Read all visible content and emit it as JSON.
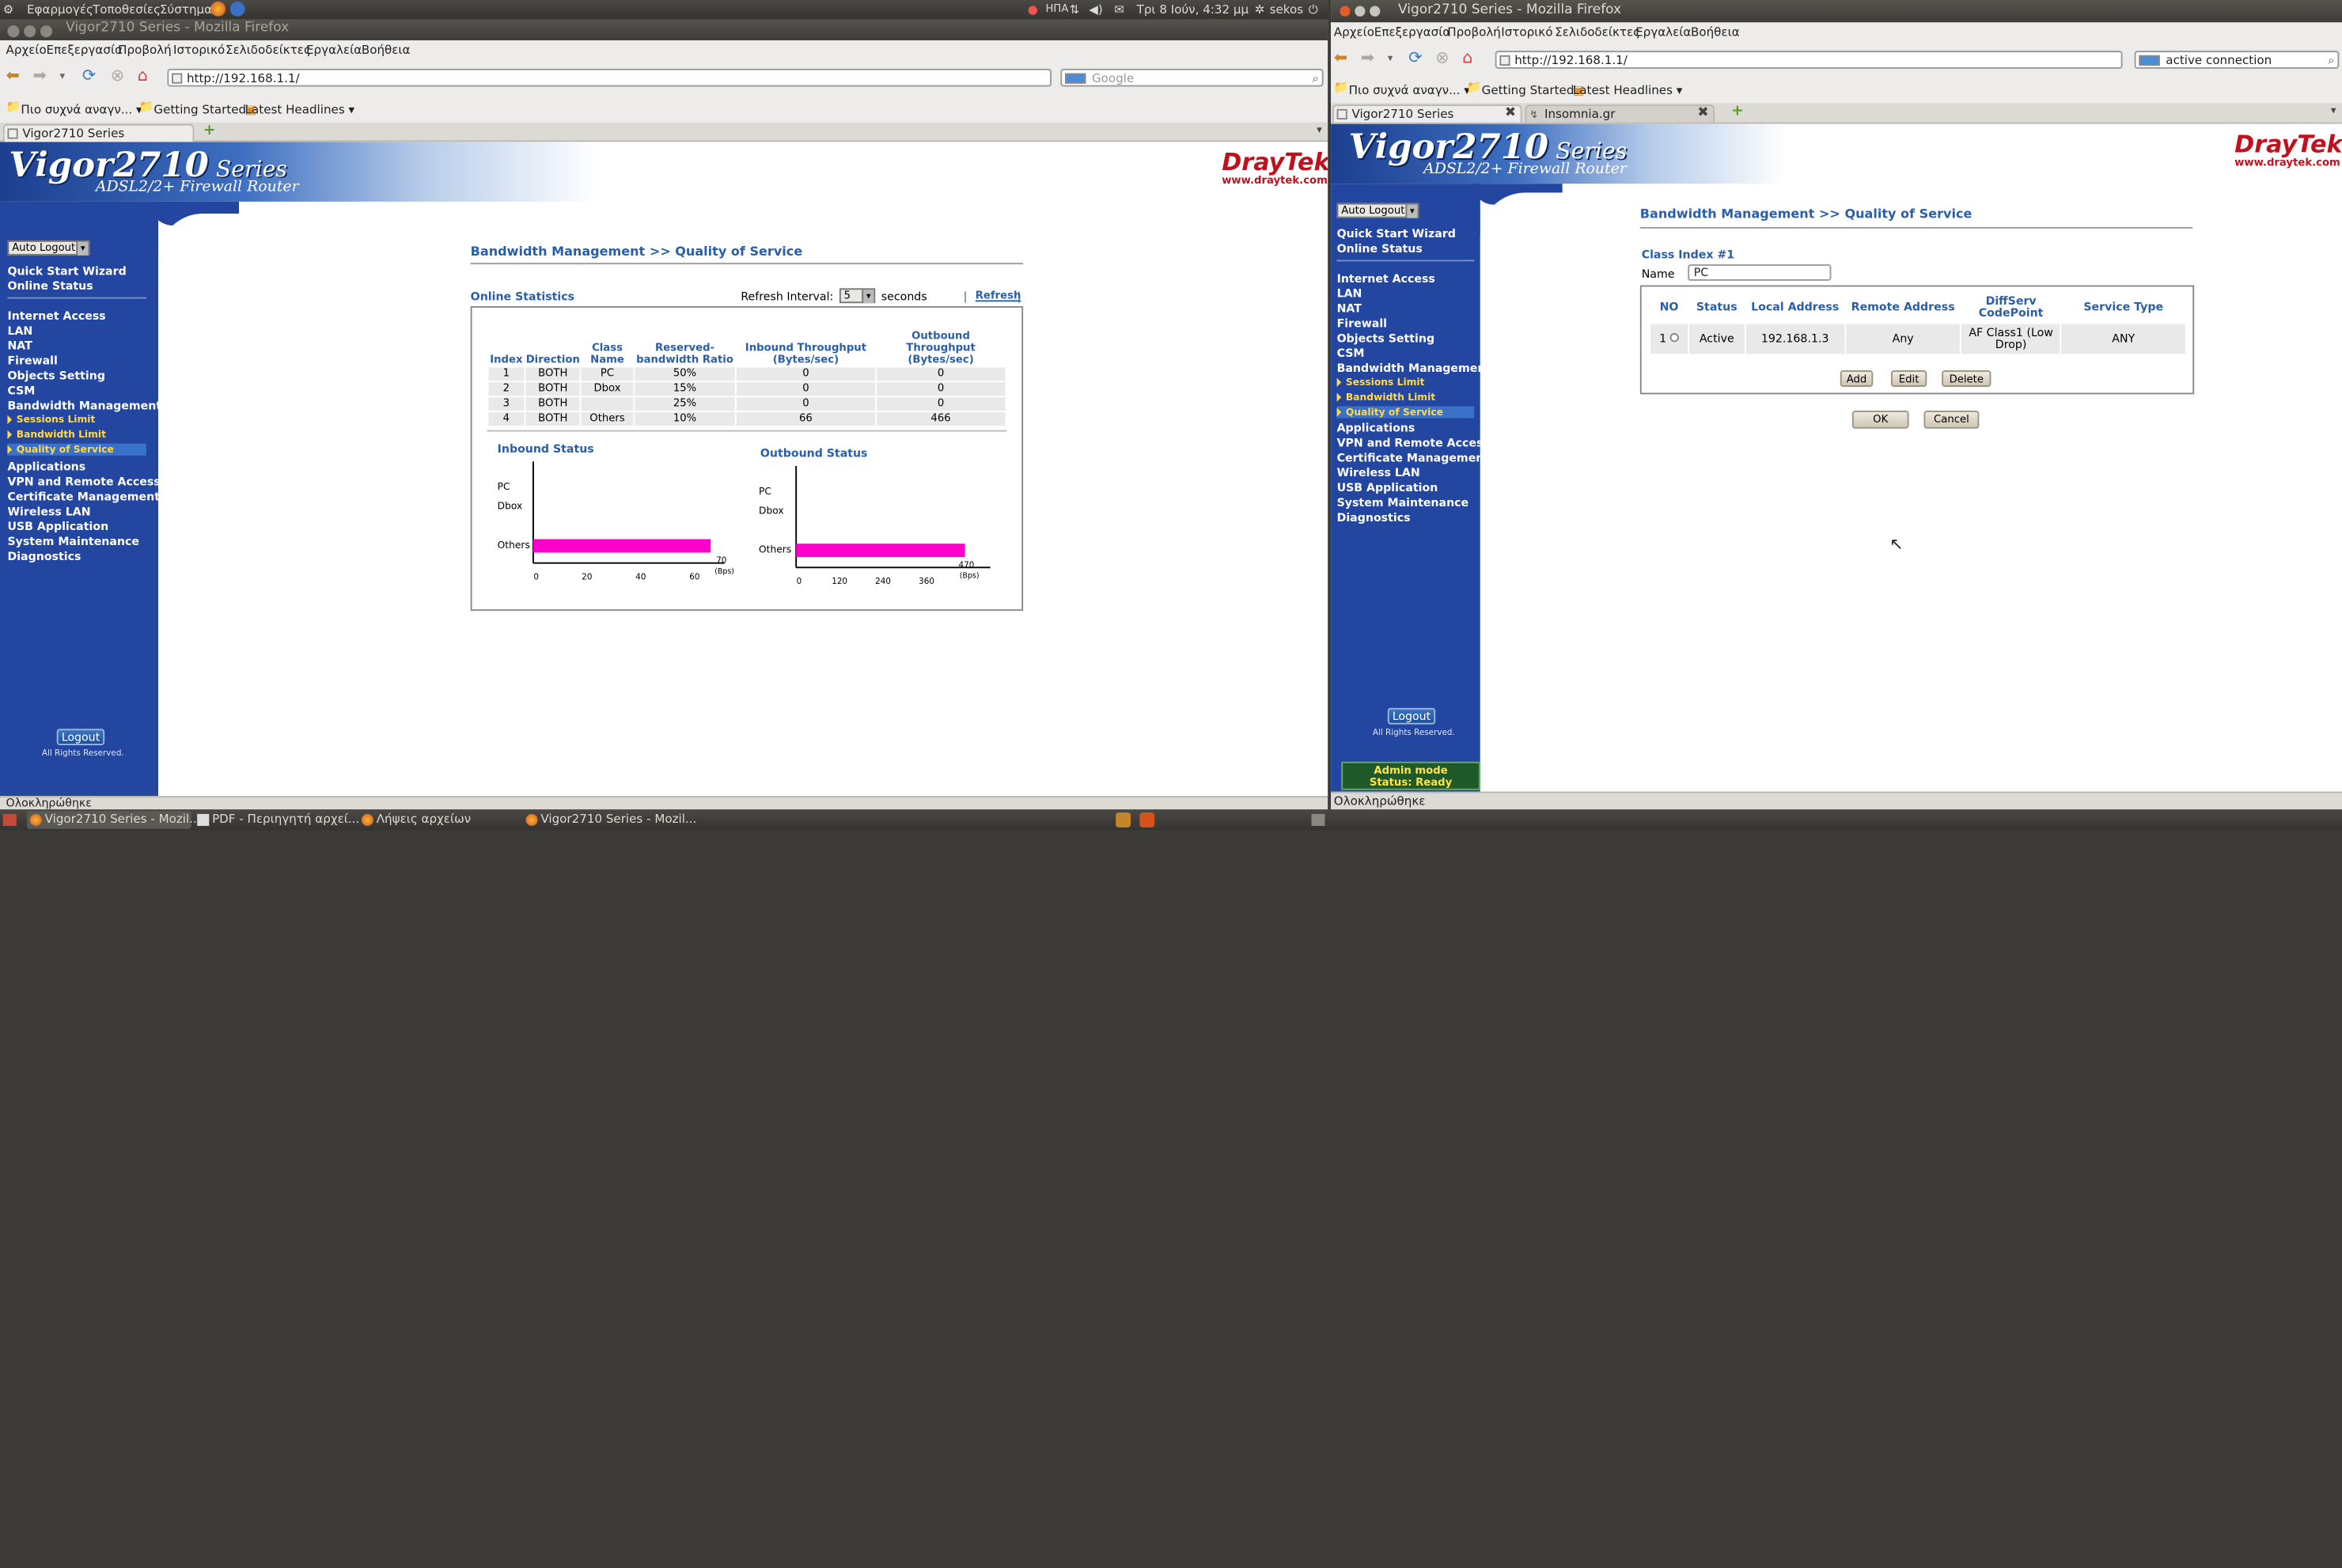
{
  "top_panel": {
    "menus": [
      "Εφαρμογές",
      "Τοποθεσίες",
      "Σύστημα"
    ],
    "keyboard": "ΗΠΑ",
    "clock": "Τρι 8 Ιούν, 4:32 μμ",
    "user": "sekos"
  },
  "left_window": {
    "title": "Vigor2710 Series - Mozilla Firefox",
    "menu": [
      "Αρχείο",
      "Επεξεργασία",
      "Προβολή",
      "Ιστορικό",
      "Σελιδοδείκτες",
      "Εργαλεία",
      "Βοήθεια"
    ],
    "url": "http://192.168.1.1/",
    "search_placeholder": "Google",
    "bookmarks": [
      "Πιο συχνά αναγν... ▾",
      "Getting Started",
      "Latest Headlines ▾"
    ],
    "tabs": [
      "Vigor2710 Series"
    ],
    "status": "Ολοκληρώθηκε"
  },
  "right_window": {
    "title": "Vigor2710 Series - Mozilla Firefox",
    "menu": [
      "Αρχείο",
      "Επεξεργασία",
      "Προβολή",
      "Ιστορικό",
      "Σελιδοδείκτες",
      "Εργαλεία",
      "Βοήθεια"
    ],
    "url": "http://192.168.1.1/",
    "search_value": "active connection",
    "bookmarks": [
      "Πιο συχνά αναγν... ▾",
      "Getting Started",
      "Latest Headlines ▾"
    ],
    "tabs": [
      "Vigor2710 Series",
      "Insomnia.gr"
    ],
    "status": "Ολοκληρώθηκε"
  },
  "router": {
    "brand": "Vigor2710",
    "series": "Series",
    "subtitle": "ADSL2/2+ Firewall Router",
    "logo": "DrayTek",
    "logo_url": "www.draytek.com",
    "auto_logout": "Auto Logout",
    "menu": {
      "quick_start": "Quick Start Wizard",
      "online_status": "Online Status",
      "internet_access": "Internet Access",
      "lan": "LAN",
      "nat": "NAT",
      "firewall": "Firewall",
      "objects": "Objects Setting",
      "csm": "CSM",
      "bandwidth": "Bandwidth Management",
      "sessions_limit": "Sessions Limit",
      "bandwidth_limit": "Bandwidth Limit",
      "qos": "Quality of Service",
      "applications": "Applications",
      "vpn": "VPN and Remote Access",
      "certificate": "Certificate Management",
      "wireless": "Wireless LAN",
      "usb": "USB Application",
      "system": "System Maintenance",
      "diagnostics": "Diagnostics"
    },
    "logout": "Logout",
    "rights": "All Rights Reserved.",
    "admin_mode": "Admin mode",
    "admin_status": "Status: Ready"
  },
  "left_page": {
    "heading": "Bandwidth Management >> Quality of Service",
    "online_statistics": "Online Statistics",
    "refresh_interval_label": "Refresh Interval:",
    "refresh_value": "5",
    "seconds": "seconds",
    "refresh_link": "Refresh",
    "columns": [
      "Index",
      "Direction",
      "Class Name",
      "Reserved-bandwidth Ratio",
      "Inbound Throughput (Bytes/sec)",
      "Outbound Throughput (Bytes/sec)"
    ],
    "rows": [
      [
        "1",
        "BOTH",
        "PC",
        "50%",
        "0",
        "0"
      ],
      [
        "2",
        "BOTH",
        "Dbox",
        "15%",
        "0",
        "0"
      ],
      [
        "3",
        "BOTH",
        "",
        "25%",
        "0",
        "0"
      ],
      [
        "4",
        "BOTH",
        "Others",
        "10%",
        "66",
        "466"
      ]
    ]
  },
  "chart_data": [
    {
      "type": "bar",
      "title": "Inbound Status",
      "categories": [
        "PC",
        "Dbox",
        "Others"
      ],
      "values": [
        0,
        0,
        66
      ],
      "xlim": [
        0,
        70
      ],
      "xticks": [
        "0",
        "20",
        "40",
        "60",
        "70"
      ],
      "unit": "(Bps)",
      "color": "#ff00cc"
    },
    {
      "type": "bar",
      "title": "Outbound Status",
      "categories": [
        "PC",
        "Dbox",
        "Others"
      ],
      "values": [
        0,
        0,
        466
      ],
      "xlim": [
        0,
        470
      ],
      "xticks": [
        "0",
        "120",
        "240",
        "360",
        "470"
      ],
      "unit": "(Bps)",
      "color": "#ff00cc"
    }
  ],
  "right_page": {
    "heading": "Bandwidth Management >> Quality of Service",
    "class_index": "Class Index #1",
    "name_label": "Name",
    "name_value": "PC",
    "columns": [
      "NO",
      "Status",
      "Local Address",
      "Remote Address",
      "DiffServ CodePoint",
      "Service Type"
    ],
    "row": {
      "no": "1",
      "status": "Active",
      "local": "192.168.1.3",
      "remote": "Any",
      "dscp": "AF Class1 (Low Drop)",
      "service": "ANY"
    },
    "add": "Add",
    "edit": "Edit",
    "delete": "Delete",
    "ok": "OK",
    "cancel": "Cancel"
  },
  "taskbar": [
    "Vigor2710 Series - Mozil...",
    "PDF - Περιηγητή αρχεί...",
    "Λήψεις αρχείων",
    "Vigor2710 Series - Mozil..."
  ]
}
